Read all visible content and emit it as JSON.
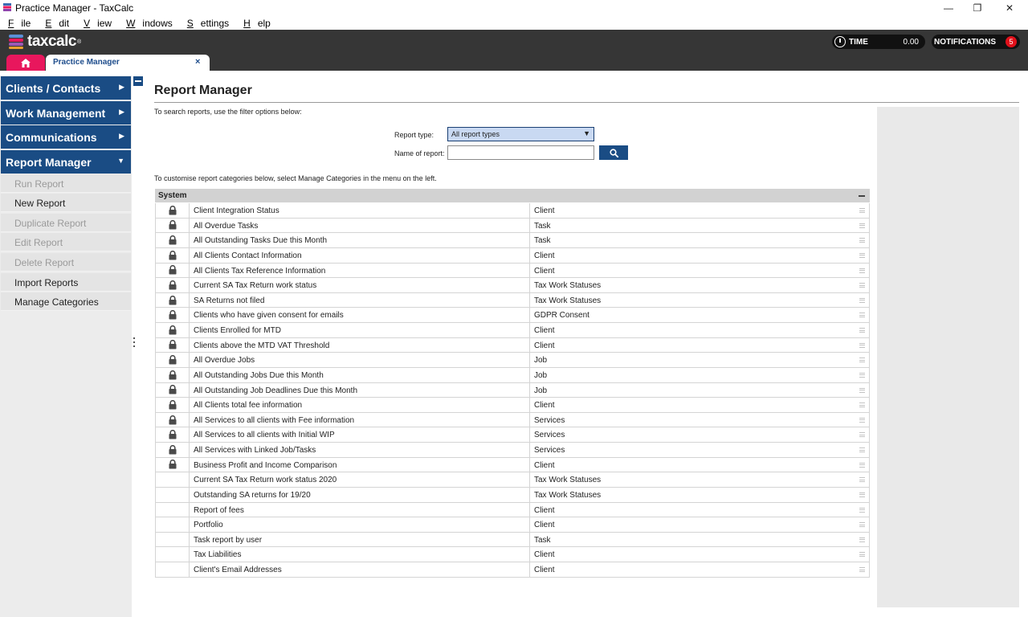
{
  "window": {
    "title": "Practice Manager - TaxCalc",
    "controls": {
      "minimize": "—",
      "restore": "❐",
      "close": "✕"
    }
  },
  "menu": [
    {
      "first": "F",
      "rest": "ile"
    },
    {
      "first": "E",
      "rest": "dit"
    },
    {
      "first": "V",
      "rest": "iew"
    },
    {
      "first": "W",
      "rest": "indows"
    },
    {
      "first": "S",
      "rest": "ettings"
    },
    {
      "first": "H",
      "rest": "elp"
    }
  ],
  "header": {
    "brand": "taxcalc",
    "brand_mark": "®",
    "time_label": "TIME",
    "time_value": "0.00",
    "notifications_label": "NOTIFICATIONS",
    "notifications_count": "5",
    "tab_label": "Practice Manager",
    "tab_close": "×"
  },
  "colors": {
    "nav_blue": "#1a4c84",
    "home_tab": "#e8175d",
    "badge_red": "#e0101a",
    "header_bg": "#363636"
  },
  "sidebar": {
    "sections": [
      {
        "label": "Clients / Contacts",
        "arrow": "▶"
      },
      {
        "label": "Work Management",
        "arrow": "▶"
      },
      {
        "label": "Communications",
        "arrow": "▶"
      },
      {
        "label": "Report Manager",
        "arrow": "▼"
      }
    ],
    "items": [
      {
        "label": "Run Report",
        "disabled": true
      },
      {
        "label": "New Report",
        "disabled": false
      },
      {
        "label": "Duplicate Report",
        "disabled": true
      },
      {
        "label": "Edit Report",
        "disabled": true
      },
      {
        "label": "Delete Report",
        "disabled": true
      },
      {
        "label": "Import Reports",
        "disabled": false
      },
      {
        "label": "Manage Categories",
        "disabled": false
      }
    ]
  },
  "main": {
    "title": "Report Manager",
    "search_hint": "To search reports, use the filter options below:",
    "report_type_label": "Report type:",
    "report_type_value": "All report types",
    "name_label": "Name of report:",
    "name_value": "",
    "customise_hint": "To customise report categories below, select Manage Categories in the menu on the left."
  },
  "table": {
    "group": "System",
    "rows": [
      {
        "name": "Client Integration Status",
        "category": "Client",
        "locked": true
      },
      {
        "name": "All Overdue Tasks",
        "category": "Task",
        "locked": true
      },
      {
        "name": "All Outstanding Tasks Due this Month",
        "category": "Task",
        "locked": true
      },
      {
        "name": "All Clients Contact Information",
        "category": "Client",
        "locked": true
      },
      {
        "name": "All Clients Tax Reference Information",
        "category": "Client",
        "locked": true
      },
      {
        "name": "Current SA Tax Return work status",
        "category": "Tax Work Statuses",
        "locked": true
      },
      {
        "name": "SA Returns not filed",
        "category": "Tax Work Statuses",
        "locked": true
      },
      {
        "name": "Clients who have given consent for emails",
        "category": "GDPR Consent",
        "locked": true
      },
      {
        "name": "Clients Enrolled for MTD",
        "category": "Client",
        "locked": true
      },
      {
        "name": "Clients above the MTD VAT Threshold",
        "category": "Client",
        "locked": true
      },
      {
        "name": "All Overdue Jobs",
        "category": "Job",
        "locked": true
      },
      {
        "name": "All Outstanding Jobs Due this Month",
        "category": "Job",
        "locked": true
      },
      {
        "name": "All Outstanding Job Deadlines Due this Month",
        "category": "Job",
        "locked": true
      },
      {
        "name": "All Clients total fee information",
        "category": "Client",
        "locked": true
      },
      {
        "name": "All Services to all clients with Fee information",
        "category": "Services",
        "locked": true
      },
      {
        "name": "All Services to all clients with Initial WIP",
        "category": "Services",
        "locked": true
      },
      {
        "name": "All Services with Linked Job/Tasks",
        "category": "Services",
        "locked": true
      },
      {
        "name": "Business Profit and Income Comparison",
        "category": "Client",
        "locked": true
      },
      {
        "name": "Current SA Tax Return work status 2020",
        "category": "Tax Work Statuses",
        "locked": false
      },
      {
        "name": "Outstanding SA returns for 19/20",
        "category": "Tax Work Statuses",
        "locked": false
      },
      {
        "name": "Report of fees",
        "category": "Client",
        "locked": false
      },
      {
        "name": "Portfolio",
        "category": "Client",
        "locked": false
      },
      {
        "name": "Task report by user",
        "category": "Task",
        "locked": false
      },
      {
        "name": "Tax Liabilities",
        "category": "Client",
        "locked": false
      },
      {
        "name": "Client's Email Addresses",
        "category": "Client",
        "locked": false
      }
    ]
  }
}
